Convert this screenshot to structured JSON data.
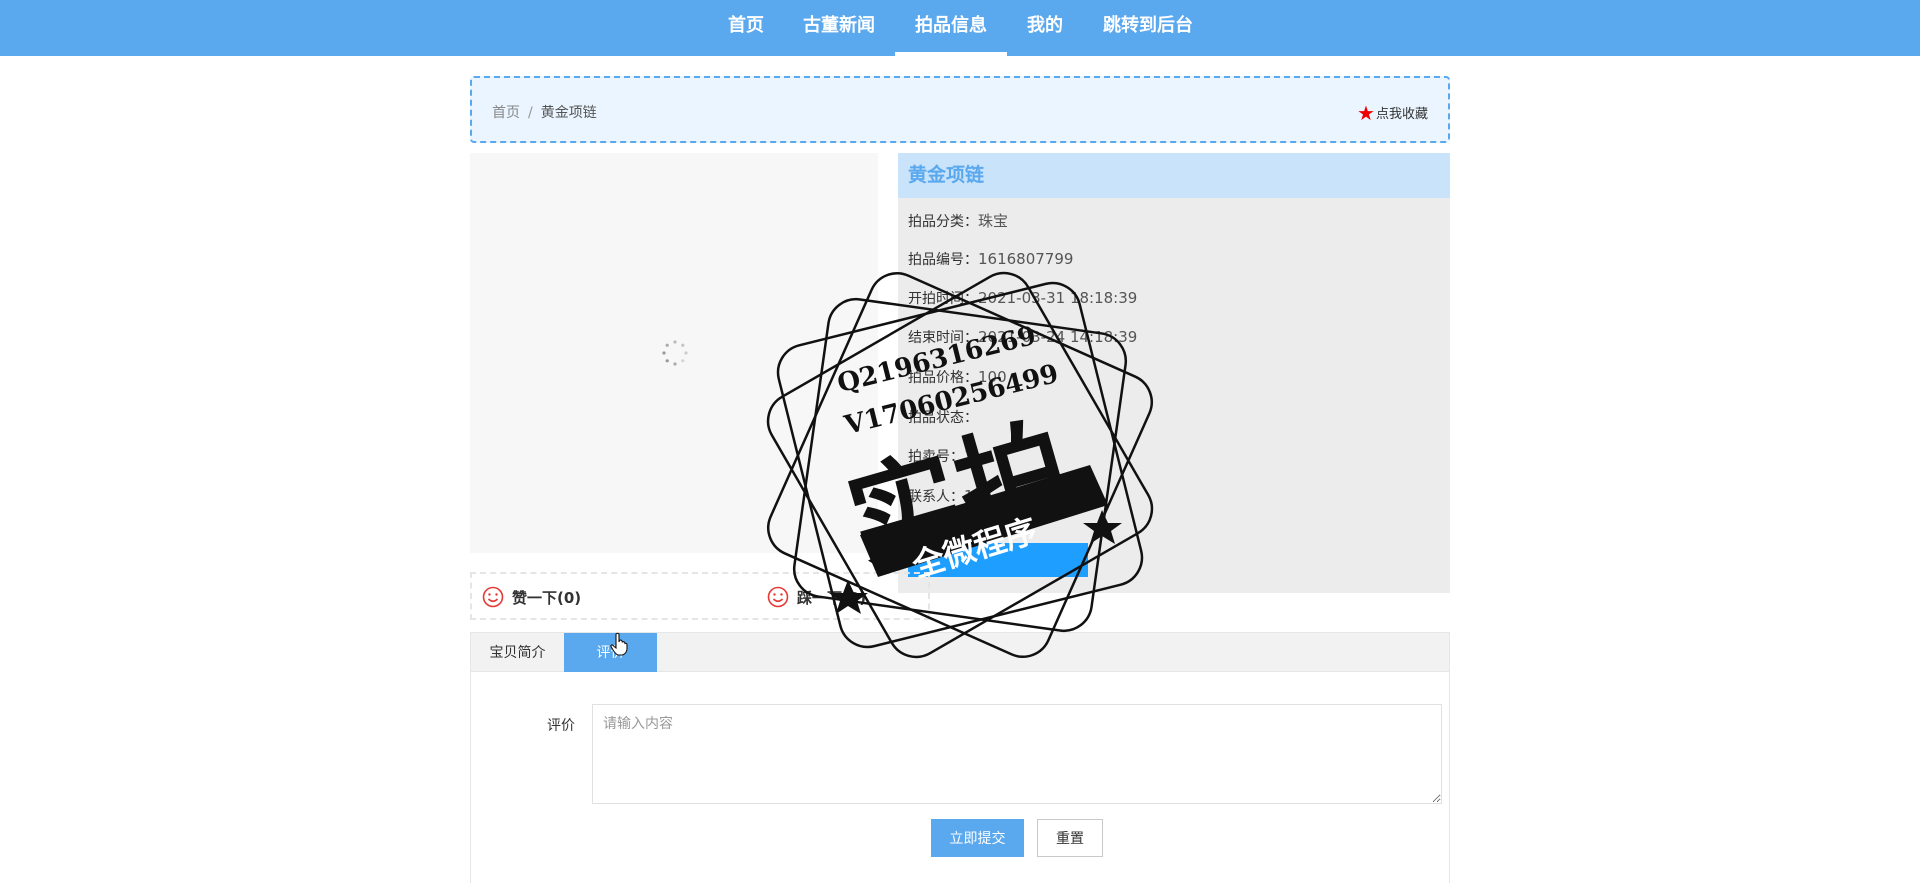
{
  "nav": {
    "items": [
      {
        "label": "首页",
        "active": false
      },
      {
        "label": "古董新闻",
        "active": false
      },
      {
        "label": "拍品信息",
        "active": true
      },
      {
        "label": "我的",
        "active": false
      },
      {
        "label": "跳转到后台",
        "active": false
      }
    ]
  },
  "breadcrumb": {
    "home": "首页",
    "separator": "/",
    "current": "黄金项链"
  },
  "favorite": {
    "label": "点我收藏",
    "icon": "star-icon",
    "icon_color": "#ee0000"
  },
  "product": {
    "title": "黄金项链",
    "fields": [
      {
        "label": "拍品分类：",
        "value": "珠宝"
      },
      {
        "label": "拍品编号：",
        "value": "1616807799"
      },
      {
        "label": "开拍时间：",
        "value": "2021-03-31 18:18:39"
      },
      {
        "label": "结束时间：",
        "value": "2021-03-24 14:18:39"
      },
      {
        "label": "拍品价格：",
        "value": "100"
      },
      {
        "label": "拍品状态：",
        "value": ""
      },
      {
        "label": "拍卖号：",
        "value": "1"
      },
      {
        "label": "联系人：",
        "value": "13"
      }
    ]
  },
  "votes": {
    "like": "赞一下(0)",
    "dislike": "踩一下(0)"
  },
  "tabs": [
    {
      "label": "宝贝简介",
      "active": false
    },
    {
      "label": "评价",
      "active": true
    }
  ],
  "review_form": {
    "label": "评价",
    "placeholder": "请输入内容",
    "submit_label": "立即提交",
    "reset_label": "重置"
  },
  "watermark": {
    "line1": "Q2196316269",
    "line2": "V17060256499",
    "main": "实拍",
    "banner": "全微程序"
  },
  "colors": {
    "primary": "#5aa8ee",
    "panel_head": "#c9e3fb",
    "accent_star": "#ee0000"
  }
}
